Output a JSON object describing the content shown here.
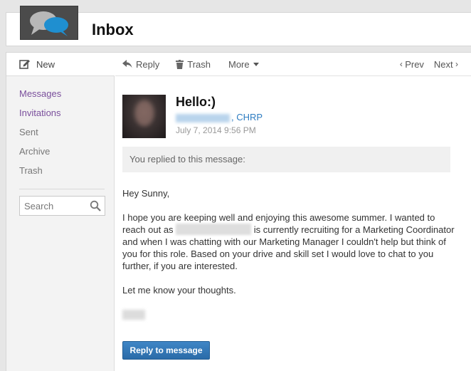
{
  "header": {
    "title": "Inbox",
    "logo_icon": "speech-bubbles-icon"
  },
  "sidebar": {
    "new_label": "New",
    "nav": [
      {
        "label": "Messages",
        "active": true
      },
      {
        "label": "Invitations",
        "active": true
      },
      {
        "label": "Sent",
        "active": false
      },
      {
        "label": "Archive",
        "active": false
      },
      {
        "label": "Trash",
        "active": false
      }
    ],
    "search_placeholder": "Search"
  },
  "toolbar": {
    "reply_label": "Reply",
    "trash_label": "Trash",
    "more_label": "More",
    "prev_label": "Prev",
    "next_label": "Next"
  },
  "message": {
    "subject": "Hello:)",
    "sender_suffix": ", CHRP",
    "date": "July 7, 2014 9:56 PM",
    "replied_notice": "You replied to this message:",
    "greeting": "Hey Sunny,",
    "para1_before": "I hope you are keeping well and enjoying this awesome summer. I wanted to reach out as ",
    "para1_after": " is currently recruiting for a Marketing Coordinator and when I was chatting with our Marketing Manager I couldn't help but think of you for this role. Based on your drive and skill set I would love to chat to you further, if you are interested.",
    "para2": "Let me know your thoughts.",
    "reply_button": "Reply to message"
  },
  "colors": {
    "link": "#2d7cc1",
    "nav_active": "#7a4f9c",
    "button": "#2f75b5"
  }
}
